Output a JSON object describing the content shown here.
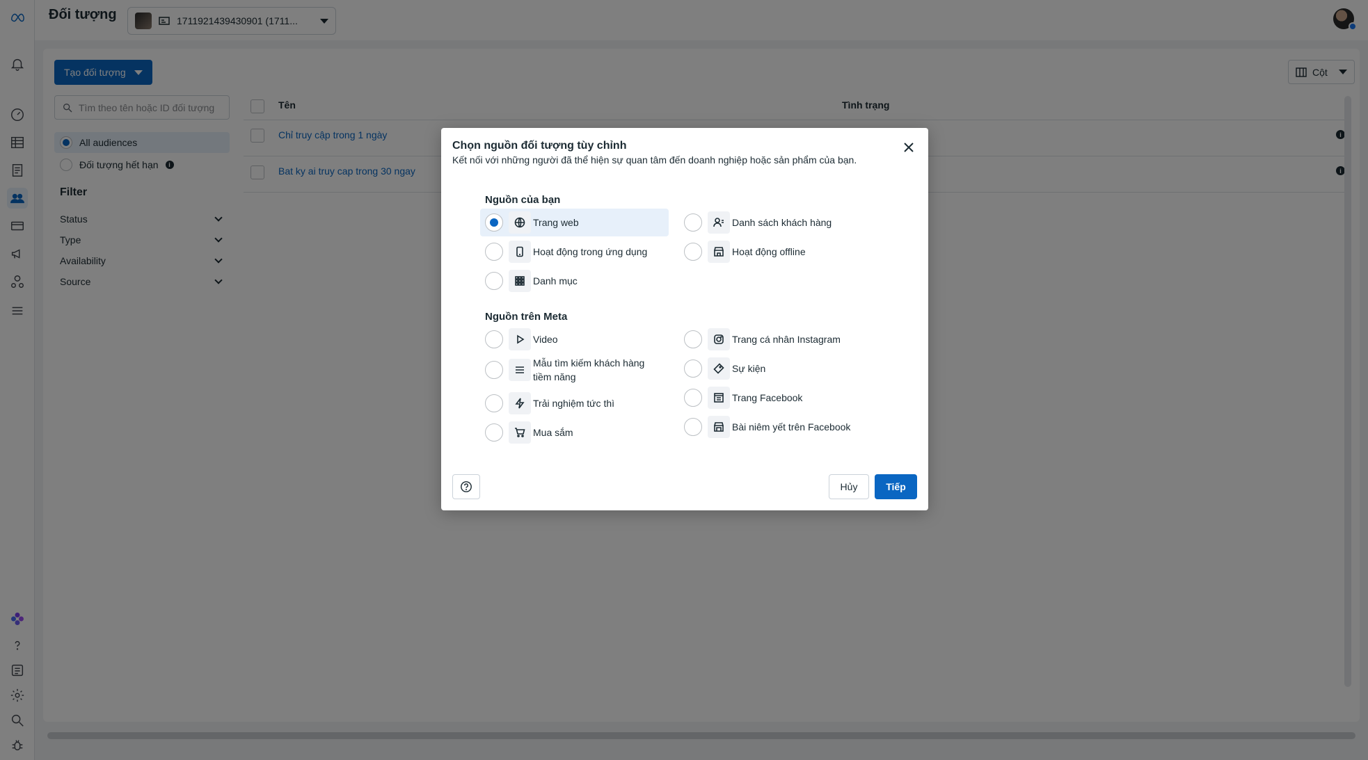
{
  "header": {
    "title": "Đối tượng",
    "account_label": "1711921439430901 (1711..."
  },
  "toolbar": {
    "create_label": "Tạo đối tượng",
    "columns_label": "Cột"
  },
  "search": {
    "placeholder": "Tìm theo tên hoặc ID đối tượng"
  },
  "audience_filter": {
    "items": [
      {
        "label": "All audiences",
        "selected": true
      },
      {
        "label": "Đối tượng hết hạn",
        "selected": false
      }
    ]
  },
  "filter": {
    "title": "Filter",
    "rows": [
      "Status",
      "Type",
      "Availability",
      "Source"
    ]
  },
  "table": {
    "columns": [
      "Tên",
      "Tình trạng"
    ],
    "rows": [
      {
        "name": "Chỉ truy cập trong 1 ngày"
      },
      {
        "name": "Bat ky ai truy cap trong 30 ngay"
      }
    ]
  },
  "dialog": {
    "title": "Chọn nguồn đối tượng tùy chỉnh",
    "subtitle": "Kết nối với những người đã thể hiện sự quan tâm đến doanh nghiệp hoặc sản phẩm của bạn.",
    "your_sources": {
      "title": "Nguồn của bạn",
      "options": [
        {
          "label": "Trang web",
          "icon": "globe-icon",
          "selected": true
        },
        {
          "label": "Danh sách khách hàng",
          "icon": "customer-list-icon",
          "selected": false
        },
        {
          "label": "Hoạt động trong ứng dụng",
          "icon": "mobile-app-icon",
          "selected": false
        },
        {
          "label": "Hoạt động offline",
          "icon": "store-icon",
          "selected": false
        },
        {
          "label": "Danh mục",
          "icon": "catalog-grid-icon",
          "selected": false
        }
      ]
    },
    "meta_sources": {
      "title": "Nguồn trên Meta",
      "options": [
        {
          "label": "Video",
          "icon": "play-icon"
        },
        {
          "label": "Trang cá nhân Instagram",
          "icon": "instagram-icon"
        },
        {
          "label": "Mẫu tìm kiếm khách hàng tiềm năng",
          "icon": "form-lines-icon"
        },
        {
          "label": "Sự kiện",
          "icon": "ticket-icon"
        },
        {
          "label": "Trải nghiệm tức thì",
          "icon": "lightning-icon"
        },
        {
          "label": "Trang Facebook",
          "icon": "facebook-page-icon"
        },
        {
          "label": "Mua sắm",
          "icon": "cart-icon"
        },
        {
          "label": "Bài niêm yết trên Facebook",
          "icon": "marketplace-icon"
        }
      ]
    },
    "cancel_label": "Hủy",
    "next_label": "Tiếp"
  },
  "colors": {
    "accent": "#0a66c2",
    "selected_bg": "#e7f0fa",
    "overlay": "rgba(0,0,0,0.5)"
  }
}
